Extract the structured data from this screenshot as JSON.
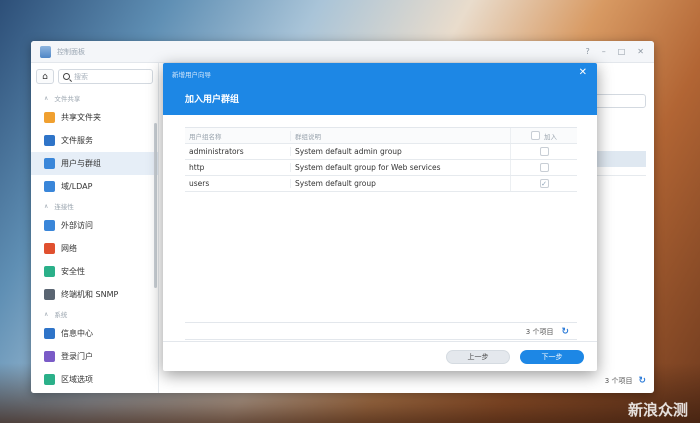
{
  "window": {
    "title": "控制面板",
    "controls": [
      "?",
      "–",
      "□",
      "✕"
    ]
  },
  "sidebar": {
    "search_placeholder": "搜索",
    "sections": [
      {
        "label": "文件共享",
        "items": [
          {
            "label": "共享文件夹",
            "icon": "folder-share-icon",
            "color": "#f0a030"
          },
          {
            "label": "文件服务",
            "icon": "file-services-icon",
            "color": "#2f74c8"
          },
          {
            "label": "用户与群组",
            "icon": "users-icon",
            "color": "#3a86d9"
          },
          {
            "label": "域/LDAP",
            "icon": "domain-icon",
            "color": "#3a86d9"
          }
        ]
      },
      {
        "label": "连接性",
        "items": [
          {
            "label": "外部访问",
            "icon": "external-access-icon",
            "color": "#3a86d9"
          },
          {
            "label": "网络",
            "icon": "network-icon",
            "color": "#e0502f"
          },
          {
            "label": "安全性",
            "icon": "security-shield-icon",
            "color": "#2bb089"
          },
          {
            "label": "终端机和 SNMP",
            "icon": "terminal-icon",
            "color": "#5a6572"
          }
        ]
      },
      {
        "label": "系统",
        "items": [
          {
            "label": "信息中心",
            "icon": "info-icon",
            "color": "#2f74c8"
          },
          {
            "label": "登录门户",
            "icon": "login-portal-icon",
            "color": "#7a5bc7"
          },
          {
            "label": "区域选项",
            "icon": "regional-icon",
            "color": "#2bb089"
          }
        ]
      }
    ],
    "active_item": "用户与群组"
  },
  "background": {
    "footer_count": "3 个项目"
  },
  "dialog": {
    "small_title": "新增用户向导",
    "title": "加入用户群组",
    "columns": [
      "用户组名称",
      "群组说明",
      "加入"
    ],
    "rows": [
      {
        "name": "administrators",
        "desc": "System default admin group",
        "checked": false
      },
      {
        "name": "http",
        "desc": "System default group for Web services",
        "checked": false
      },
      {
        "name": "users",
        "desc": "System default group",
        "checked": true
      }
    ],
    "count": "3 个项目",
    "prev_button": "上一步",
    "next_button": "下一步"
  },
  "watermark": "新浪众测",
  "colors": {
    "accent": "#1d87e5",
    "active_nav": "#e6eef7"
  }
}
